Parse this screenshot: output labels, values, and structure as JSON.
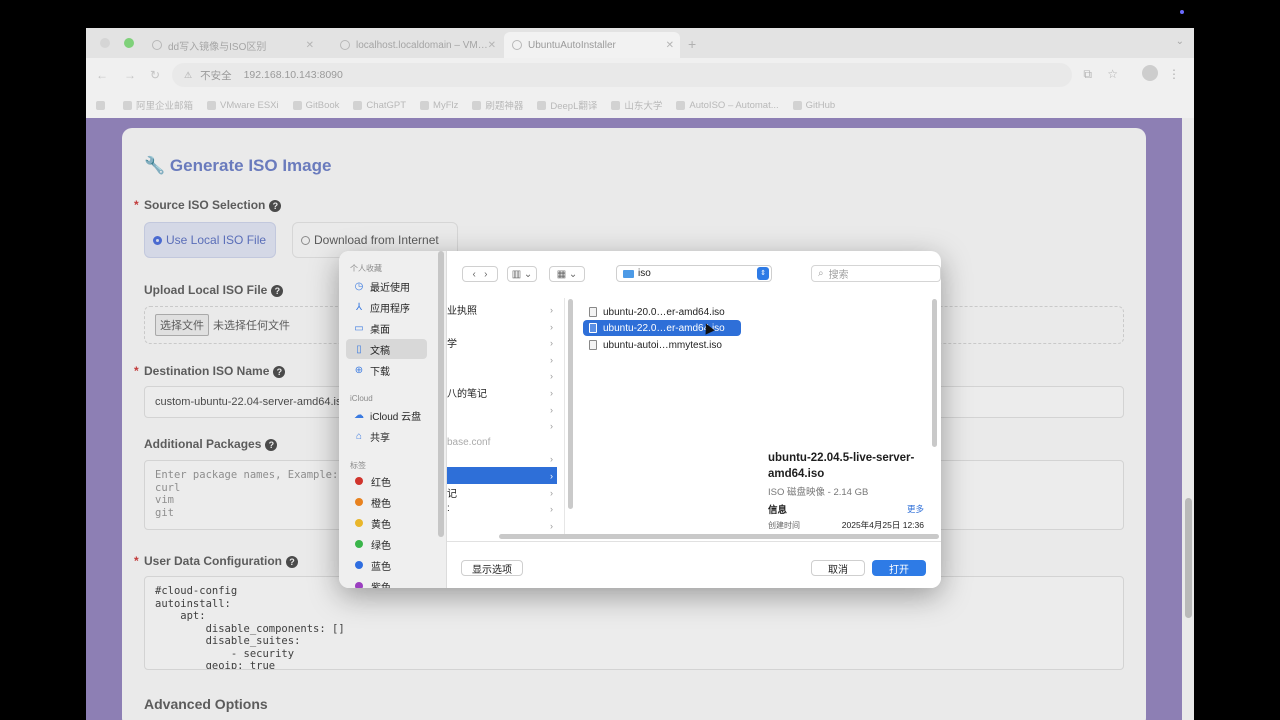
{
  "browser": {
    "tabs": [
      {
        "label": "dd写入镜像与ISO区别"
      },
      {
        "label": "localhost.localdomain – VM…"
      },
      {
        "label": "UbuntuAutoInstaller"
      }
    ],
    "new_tab_label": "+",
    "security_label": "不安全",
    "url": "192.168.10.143:8090",
    "bookmarks": [
      "阿里企业邮箱",
      "VMware ESXi",
      "GitBook",
      "ChatGPT",
      "MyFlz",
      "刷题神器",
      "DeepL翻译",
      "山东大学",
      "AutoISO – Automat...",
      "GitHub"
    ]
  },
  "form": {
    "title": "🔧 Generate ISO Image",
    "source_label": "Source ISO Selection",
    "source_options": [
      "Use Local ISO File",
      "Download from Internet"
    ],
    "selected_source": "Use Local ISO File",
    "upload_label": "Upload Local ISO File",
    "choose_file_button": "选择文件",
    "no_file_text": "未选择任何文件",
    "dest_label": "Destination ISO Name",
    "dest_value": "custom-ubuntu-22.04-server-amd64.iso",
    "packages_label": "Additional Packages",
    "packages_placeholder": "Enter package names, Example:\ncurl\nvim\ngit",
    "userdata_label": "User Data Configuration",
    "userdata_value": "#cloud-config\nautoinstall:\n    apt:\n        disable_components: []\n        disable_suites:\n            - security\n        geoip: true",
    "advanced_label": "Advanced Options",
    "help_glyph": "?"
  },
  "dialog": {
    "sidebar": {
      "favorites_header": "个人收藏",
      "favorites": [
        {
          "label": "最近使用",
          "icon": "clock-icon"
        },
        {
          "label": "应用程序",
          "icon": "apps-icon"
        },
        {
          "label": "桌面",
          "icon": "desktop-icon"
        },
        {
          "label": "文稿",
          "icon": "document-icon",
          "selected": true
        },
        {
          "label": "下载",
          "icon": "download-icon"
        }
      ],
      "icloud_header": "iCloud",
      "icloud": [
        {
          "label": "iCloud 云盘",
          "icon": "cloud-icon"
        },
        {
          "label": "共享",
          "icon": "shared-folder-icon"
        }
      ],
      "tags_header": "标签",
      "tags": [
        {
          "label": "红色",
          "color": "#d0342c"
        },
        {
          "label": "橙色",
          "color": "#e8821e"
        },
        {
          "label": "黄色",
          "color": "#e9b62a"
        },
        {
          "label": "绿色",
          "color": "#3ab54a"
        },
        {
          "label": "蓝色",
          "color": "#2f6ee0"
        },
        {
          "label": "紫色",
          "color": "#9b3fc0"
        }
      ]
    },
    "current_folder": "iso",
    "search_placeholder": "搜索",
    "column1": [
      {
        "label": "业执照",
        "chevron": true
      },
      {
        "label": "",
        "chevron": true
      },
      {
        "label": "学",
        "chevron": true
      },
      {
        "label": "",
        "chevron": true
      },
      {
        "label": "",
        "chevron": true
      },
      {
        "label": "八的笔记",
        "chevron": true
      },
      {
        "label": "",
        "chevron": true
      },
      {
        "label": "",
        "chevron": true
      },
      {
        "label": "base.conf",
        "chevron": false,
        "dim": true
      },
      {
        "label": "",
        "chevron": true
      },
      {
        "label": "",
        "chevron": true,
        "selected": true
      },
      {
        "label": "记",
        "chevron": true
      },
      {
        "label": ":",
        "chevron": true
      },
      {
        "label": "",
        "chevron": true
      }
    ],
    "files": [
      {
        "name": "ubuntu-20.0…er-amd64.iso"
      },
      {
        "name": "ubuntu-22.0…er-amd64.iso",
        "selected": true
      },
      {
        "name": "ubuntu-autoi…mmytest.iso"
      }
    ],
    "preview": {
      "name": "ubuntu-22.04.5-live-server-amd64.iso",
      "kind_size": "ISO 磁盘映像 - 2.14 GB",
      "info_label": "信息",
      "more_label": "更多",
      "created_label": "创建时间",
      "created_value": "2025年4月25日 12:36"
    },
    "show_options_button": "显示选项",
    "cancel_button": "取消",
    "open_button": "打开"
  }
}
